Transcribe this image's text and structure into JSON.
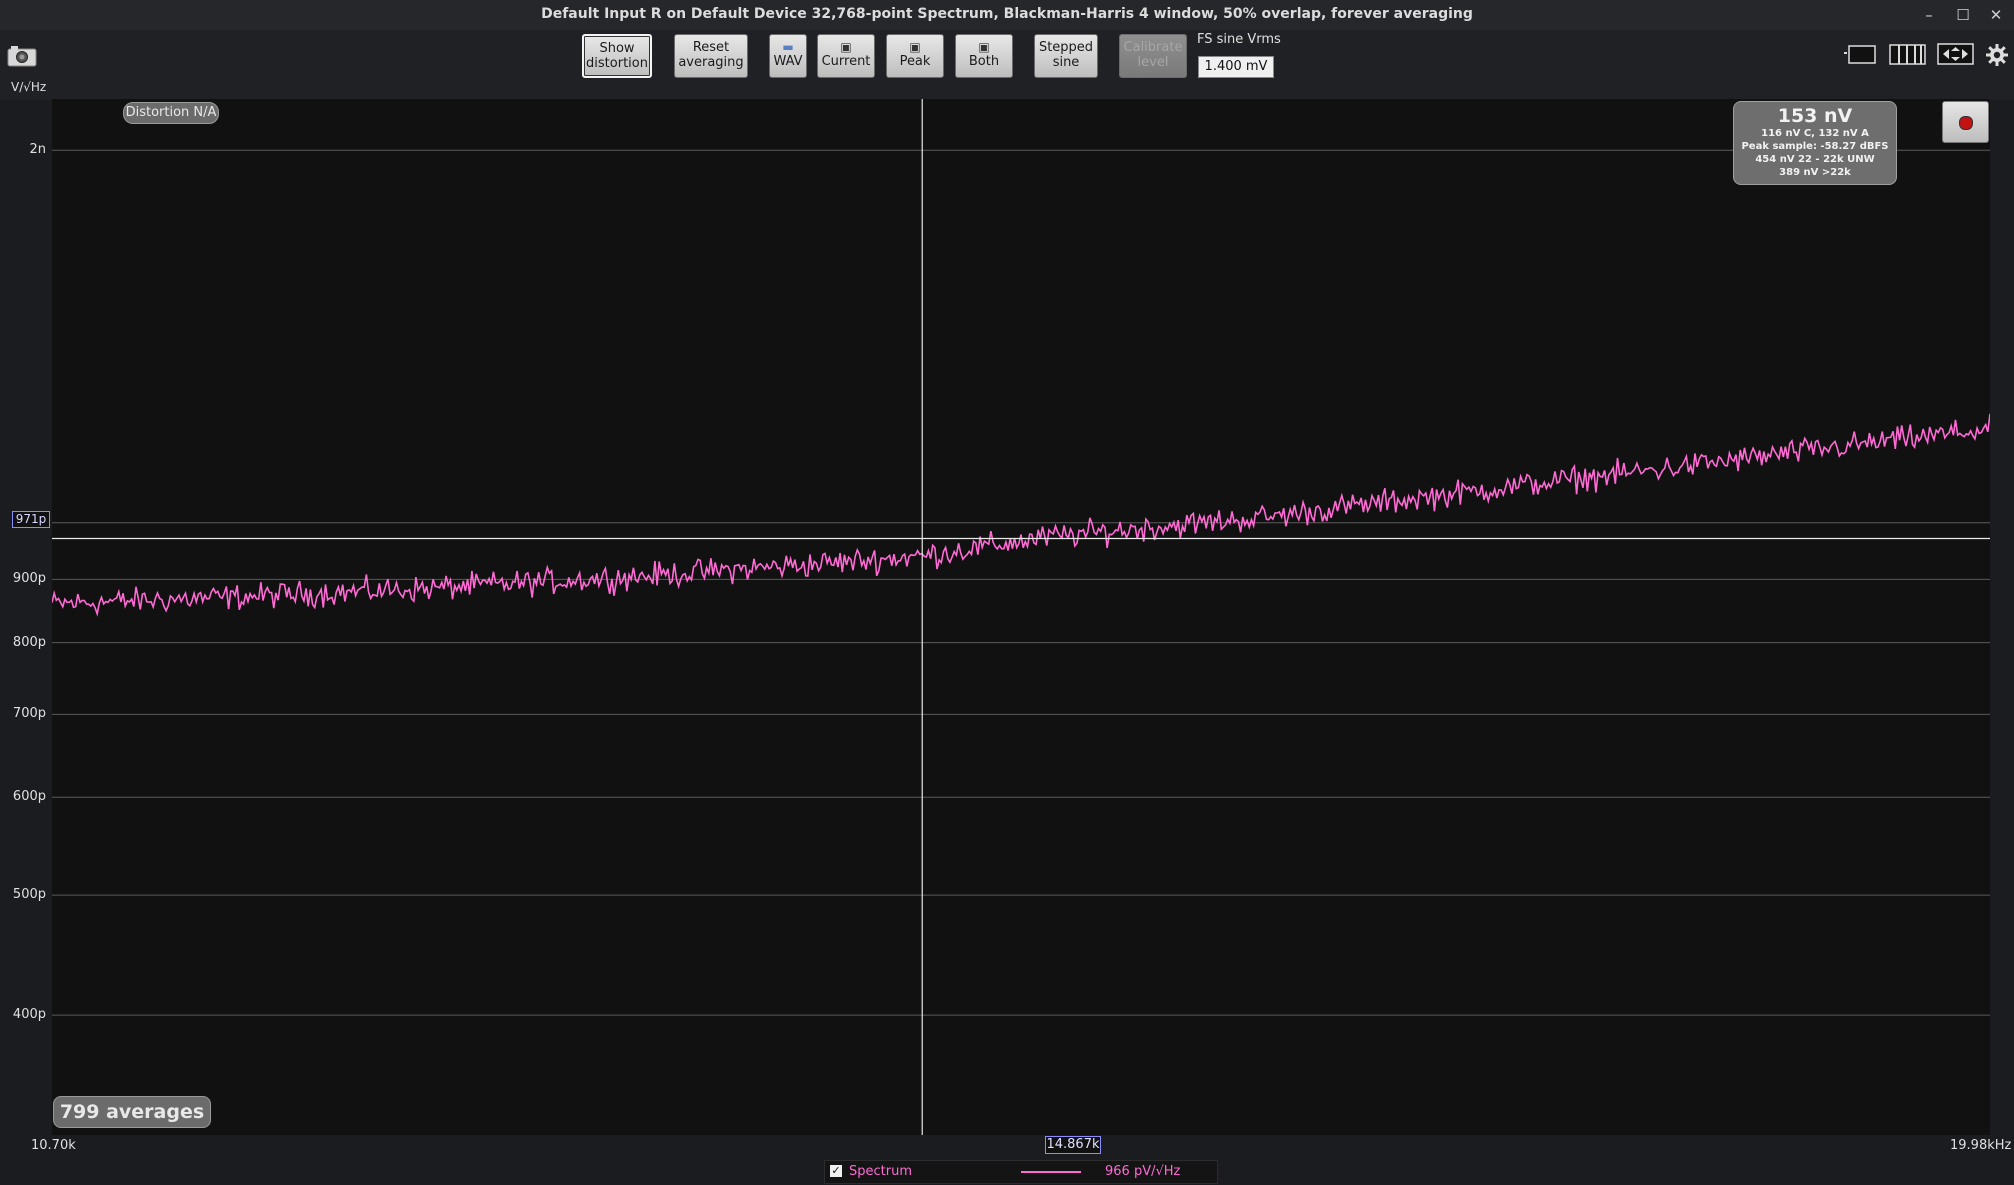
{
  "window": {
    "title": "Default Input R on Default Device 32,768-point Spectrum, Blackman-Harris 4 window, 50% overlap, forever averaging",
    "controls": [
      "–",
      "☐",
      "✕"
    ]
  },
  "toolbar": {
    "show_distortion": [
      "Show",
      "distortion"
    ],
    "reset_averaging": [
      "Reset",
      "averaging"
    ],
    "wav": "WAV",
    "current": "Current",
    "peak": "Peak",
    "both": "Both",
    "stepped_sine": [
      "Stepped",
      "sine"
    ],
    "calibrate_level": [
      "Calibrate",
      "level"
    ],
    "fs_label": "FS sine Vrms",
    "fs_value": "1.400 mV"
  },
  "icons": {
    "camera": "camera-icon",
    "single-view": "single-window-icon",
    "multi-view": "bars-view-icon",
    "fullscreen": "expand-arrows-icon",
    "settings": "gear-icon",
    "save": "floppy-icon",
    "open": "folder-icon"
  },
  "plot": {
    "unit_label": "V/√Hz",
    "distortion_badge": "Distortion N/A",
    "averages_badge": "799 averages",
    "cursor_y_label": "971p",
    "cursor_x_label": "14.867k",
    "x_start_label": "10.70k",
    "x_end_label": "19.98kHz",
    "colors": {
      "trace": "#ff6ad5",
      "grid": "#5a5a5a",
      "cursor": "#e8e8e8",
      "background": "#111111"
    }
  },
  "readout": {
    "main": "153 nV",
    "lines": [
      "116 nV C, 132 nV A",
      "Peak sample: -58.27 dBFS",
      "454 nV 22 - 22k UNW",
      "389 nV >22k"
    ]
  },
  "legend": {
    "checked": true,
    "name": "Spectrum",
    "value": "966 pV/√Hz"
  },
  "chart_data": {
    "type": "line",
    "y_scale": "log",
    "x_range": [
      10.7,
      19.98
    ],
    "x_unit": "kHz",
    "y_ticks": [
      {
        "label": "2n",
        "value": 2000
      },
      {
        "label": "1n",
        "value": 1000
      },
      {
        "label": "900p",
        "value": 900
      },
      {
        "label": "800p",
        "value": 800
      },
      {
        "label": "700p",
        "value": 700
      },
      {
        "label": "600p",
        "value": 600
      },
      {
        "label": "500p",
        "value": 500
      },
      {
        "label": "400p",
        "value": 400
      }
    ],
    "y_range_pV": [
      320,
      2200
    ],
    "cursor": {
      "x_kHz": 14.867,
      "y_pV": 971
    },
    "series": [
      {
        "name": "Spectrum",
        "x_kHz": [
          10.7,
          11.5,
          12.5,
          13.5,
          14.5,
          14.867,
          15.5,
          16.5,
          17.5,
          18.5,
          19.5,
          19.98
        ],
        "y_pV": [
          860,
          870,
          885,
          905,
          930,
          940,
          975,
          1010,
          1060,
          1110,
          1165,
          1190
        ],
        "noise_pct": 3.5
      }
    ]
  }
}
